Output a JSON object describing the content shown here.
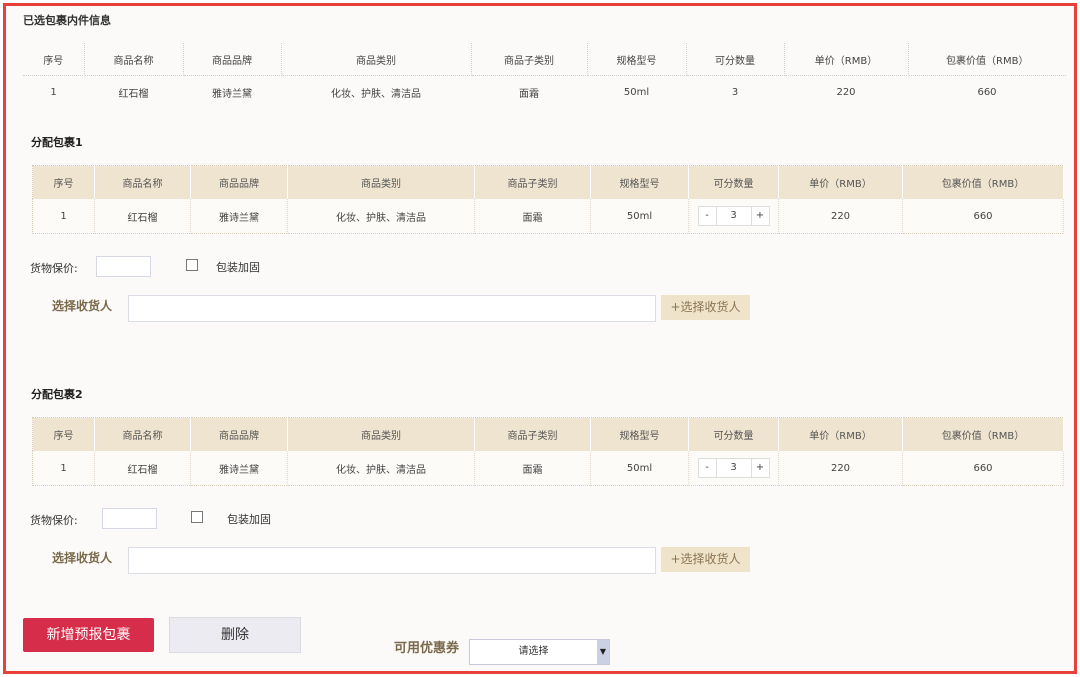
{
  "selected_section": {
    "title": "已选包裹内件信息",
    "headers": [
      "序号",
      "商品名称",
      "商品品牌",
      "商品类别",
      "商品子类别",
      "规格型号",
      "可分数量",
      "单价（RMB）",
      "包裹价值（RMB）"
    ],
    "rows": [
      [
        "1",
        "红石榴",
        "雅诗兰黛",
        "化妆、护肤、清洁品",
        "面霜",
        "50ml",
        "3",
        "220",
        "660"
      ]
    ]
  },
  "parcels": [
    {
      "title": "分配包裹1",
      "headers": [
        "序号",
        "商品名称",
        "商品品牌",
        "商品类别",
        "商品子类别",
        "规格型号",
        "可分数量",
        "单价（RMB）",
        "包裹价值（RMB）"
      ],
      "row": {
        "index": "1",
        "name": "红石榴",
        "brand": "雅诗兰黛",
        "category": "化妆、护肤、清洁品",
        "subcategory": "面霜",
        "spec": "50ml",
        "qty": "3",
        "unit_price": "220",
        "value": "660"
      },
      "stepper": {
        "minus": "-",
        "plus": "+"
      },
      "insure_label": "货物保价:",
      "reinforce_label": "包装加固",
      "reinforce_checked": false,
      "receiver_label": "选择收货人",
      "receiver_value": "",
      "receiver_button": "+选择收货人"
    },
    {
      "title": "分配包裹2",
      "headers": [
        "序号",
        "商品名称",
        "商品品牌",
        "商品类别",
        "商品子类别",
        "规格型号",
        "可分数量",
        "单价（RMB）",
        "包裹价值（RMB）"
      ],
      "row": {
        "index": "1",
        "name": "红石榴",
        "brand": "雅诗兰黛",
        "category": "化妆、护肤、清洁品",
        "subcategory": "面霜",
        "spec": "50ml",
        "qty": "3",
        "unit_price": "220",
        "value": "660"
      },
      "stepper": {
        "minus": "-",
        "plus": "+"
      },
      "insure_label": "货物保价:",
      "reinforce_label": "包装加固",
      "reinforce_checked": false,
      "receiver_label": "选择收货人",
      "receiver_value": "",
      "receiver_button": "+选择收货人"
    }
  ],
  "actions": {
    "add_label": "新增预报包裹",
    "delete_label": "删除"
  },
  "coupon": {
    "label": "可用优惠券",
    "selected": "请选择",
    "arrow_icon": "chevron-down-icon"
  },
  "colors": {
    "frame_border": "#e8403a",
    "header_bg": "#efe4cf",
    "add_button": "#d62e4a",
    "receiver_button": "#efe3c9"
  }
}
